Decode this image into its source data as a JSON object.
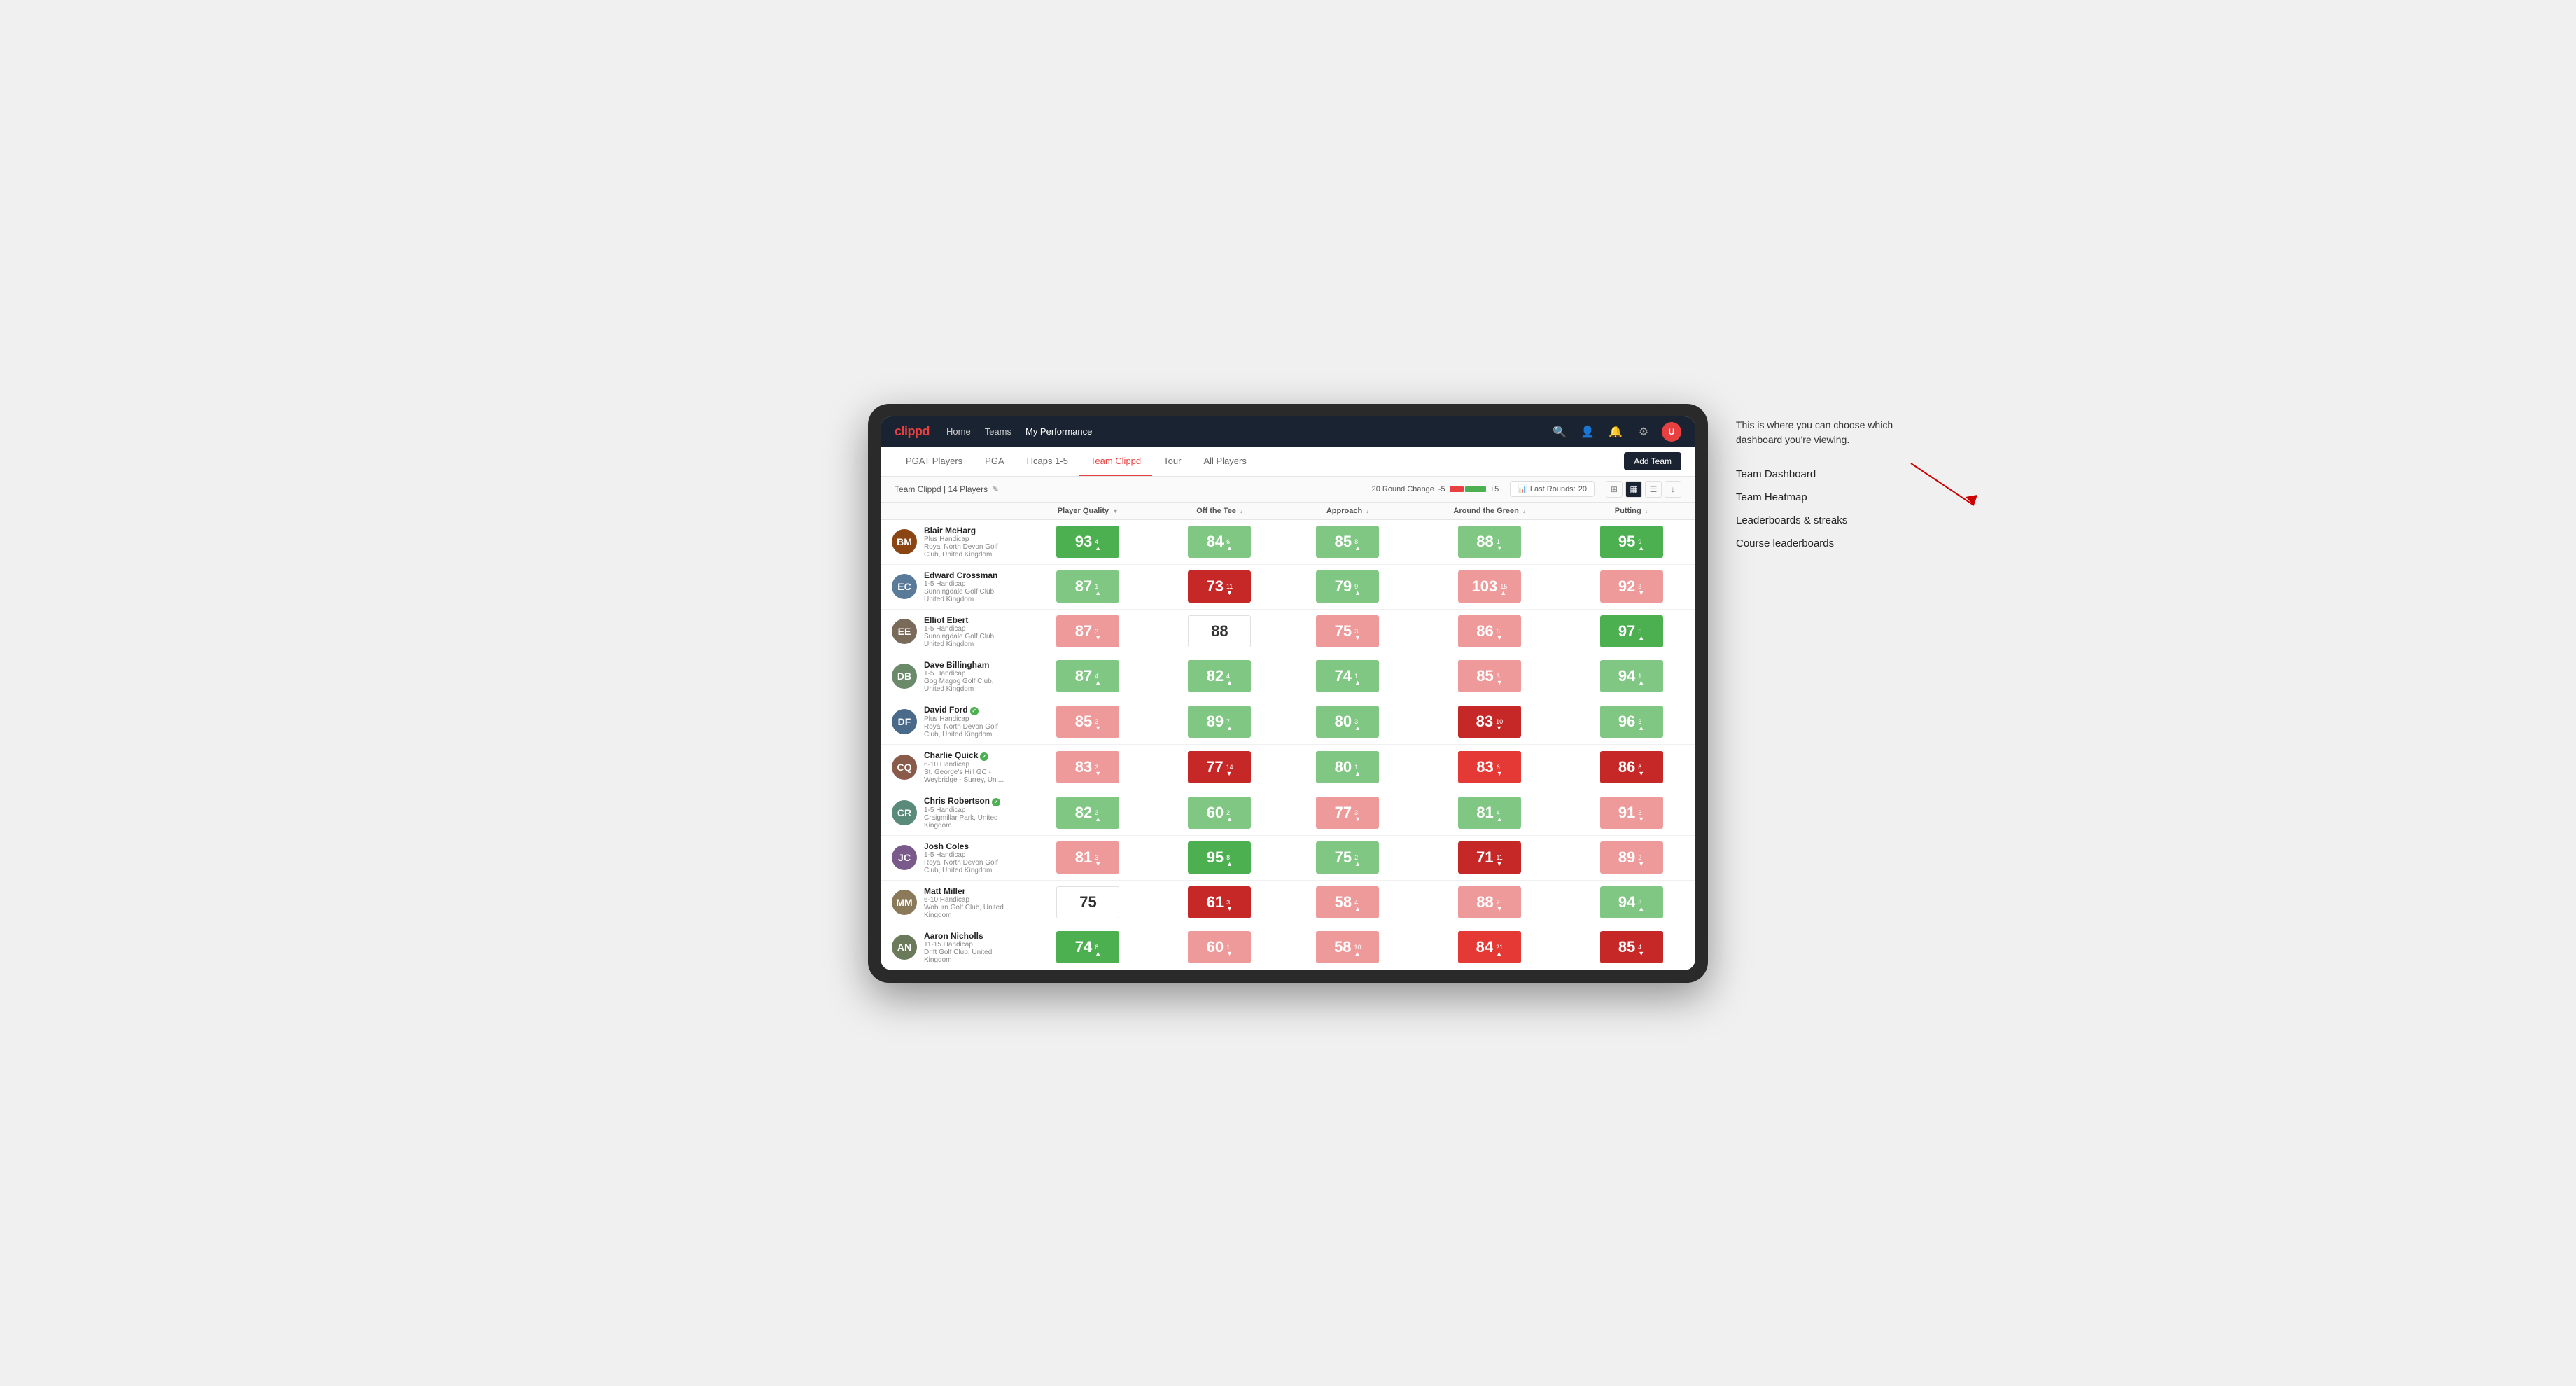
{
  "annotation": {
    "intro": "This is where you can choose which dashboard you're viewing.",
    "items": [
      "Team Dashboard",
      "Team Heatmap",
      "Leaderboards & streaks",
      "Course leaderboards"
    ]
  },
  "navbar": {
    "logo": "clippd",
    "links": [
      "Home",
      "Teams",
      "My Performance"
    ],
    "active_link": "My Performance"
  },
  "subnav": {
    "tabs": [
      "PGAT Players",
      "PGA",
      "Hcaps 1-5",
      "Team Clippd",
      "Tour",
      "All Players"
    ],
    "active_tab": "Team Clippd",
    "add_team_label": "Add Team"
  },
  "toolbar": {
    "team_label": "Team Clippd | 14 Players",
    "round_change_label": "20 Round Change",
    "rc_minus": "-5",
    "rc_plus": "+5",
    "last_rounds_label": "Last Rounds:",
    "last_rounds_value": "20"
  },
  "table": {
    "col_headers": [
      "Player Quality ↓",
      "Off the Tee ↓",
      "Approach ↓",
      "Around the Green ↓",
      "Putting ↓"
    ],
    "players": [
      {
        "name": "Blair McHarg",
        "handicap": "Plus Handicap",
        "club": "Royal North Devon Golf Club, United Kingdom",
        "avatar_color": "#8B4513",
        "initials": "BM",
        "scores": [
          {
            "value": 93,
            "change": "4▲",
            "color": "green-med"
          },
          {
            "value": 84,
            "change": "6▲",
            "color": "green-light"
          },
          {
            "value": 85,
            "change": "8▲",
            "color": "green-light"
          },
          {
            "value": 88,
            "change": "1▼",
            "color": "green-light"
          },
          {
            "value": 95,
            "change": "9▲",
            "color": "green-med"
          }
        ]
      },
      {
        "name": "Edward Crossman",
        "handicap": "1-5 Handicap",
        "club": "Sunningdale Golf Club, United Kingdom",
        "avatar_color": "#5a7a9a",
        "initials": "EC",
        "scores": [
          {
            "value": 87,
            "change": "1▲",
            "color": "green-light"
          },
          {
            "value": 73,
            "change": "11▼",
            "color": "red-dark"
          },
          {
            "value": 79,
            "change": "9▲",
            "color": "green-light"
          },
          {
            "value": 103,
            "change": "15▲",
            "color": "red-light"
          },
          {
            "value": 92,
            "change": "3▼",
            "color": "red-light"
          }
        ]
      },
      {
        "name": "Elliot Ebert",
        "handicap": "1-5 Handicap",
        "club": "Sunningdale Golf Club, United Kingdom",
        "avatar_color": "#7a6a5a",
        "initials": "EE",
        "scores": [
          {
            "value": 87,
            "change": "3▼",
            "color": "red-light"
          },
          {
            "value": 88,
            "change": "",
            "color": "white"
          },
          {
            "value": 75,
            "change": "3▼",
            "color": "red-light"
          },
          {
            "value": 86,
            "change": "6▼",
            "color": "red-light"
          },
          {
            "value": 97,
            "change": "5▲",
            "color": "green-med"
          }
        ]
      },
      {
        "name": "Dave Billingham",
        "handicap": "1-5 Handicap",
        "club": "Gog Magog Golf Club, United Kingdom",
        "avatar_color": "#6a8a6a",
        "initials": "DB",
        "scores": [
          {
            "value": 87,
            "change": "4▲",
            "color": "green-light"
          },
          {
            "value": 82,
            "change": "4▲",
            "color": "green-light"
          },
          {
            "value": 74,
            "change": "1▲",
            "color": "green-light"
          },
          {
            "value": 85,
            "change": "3▼",
            "color": "red-light"
          },
          {
            "value": 94,
            "change": "1▲",
            "color": "green-light"
          }
        ]
      },
      {
        "name": "David Ford",
        "handicap": "Plus Handicap",
        "club": "Royal North Devon Golf Club, United Kingdom",
        "avatar_color": "#4a6a8a",
        "initials": "DF",
        "verified": true,
        "scores": [
          {
            "value": 85,
            "change": "3▼",
            "color": "red-light"
          },
          {
            "value": 89,
            "change": "7▲",
            "color": "green-light"
          },
          {
            "value": 80,
            "change": "3▲",
            "color": "green-light"
          },
          {
            "value": 83,
            "change": "10▼",
            "color": "red-dark"
          },
          {
            "value": 96,
            "change": "3▲",
            "color": "green-light"
          }
        ]
      },
      {
        "name": "Charlie Quick",
        "handicap": "6-10 Handicap",
        "club": "St. George's Hill GC - Weybridge - Surrey, Uni...",
        "avatar_color": "#8a5a4a",
        "initials": "CQ",
        "verified": true,
        "scores": [
          {
            "value": 83,
            "change": "3▼",
            "color": "red-light"
          },
          {
            "value": 77,
            "change": "14▼",
            "color": "red-dark"
          },
          {
            "value": 80,
            "change": "1▲",
            "color": "green-light"
          },
          {
            "value": 83,
            "change": "6▼",
            "color": "red-med"
          },
          {
            "value": 86,
            "change": "8▼",
            "color": "red-dark"
          }
        ]
      },
      {
        "name": "Chris Robertson",
        "handicap": "1-5 Handicap",
        "club": "Craigmillar Park, United Kingdom",
        "avatar_color": "#5a8a7a",
        "initials": "CR",
        "verified": true,
        "scores": [
          {
            "value": 82,
            "change": "3▲",
            "color": "green-light"
          },
          {
            "value": 60,
            "change": "2▲",
            "color": "green-light"
          },
          {
            "value": 77,
            "change": "3▼",
            "color": "red-light"
          },
          {
            "value": 81,
            "change": "4▲",
            "color": "green-light"
          },
          {
            "value": 91,
            "change": "3▼",
            "color": "red-light"
          }
        ]
      },
      {
        "name": "Josh Coles",
        "handicap": "1-5 Handicap",
        "club": "Royal North Devon Golf Club, United Kingdom",
        "avatar_color": "#7a5a8a",
        "initials": "JC",
        "scores": [
          {
            "value": 81,
            "change": "3▼",
            "color": "red-light"
          },
          {
            "value": 95,
            "change": "8▲",
            "color": "green-med"
          },
          {
            "value": 75,
            "change": "2▲",
            "color": "green-light"
          },
          {
            "value": 71,
            "change": "11▼",
            "color": "red-dark"
          },
          {
            "value": 89,
            "change": "2▼",
            "color": "red-light"
          }
        ]
      },
      {
        "name": "Matt Miller",
        "handicap": "6-10 Handicap",
        "club": "Woburn Golf Club, United Kingdom",
        "avatar_color": "#8a7a5a",
        "initials": "MM",
        "scores": [
          {
            "value": 75,
            "change": "",
            "color": "white"
          },
          {
            "value": 61,
            "change": "3▼",
            "color": "red-dark"
          },
          {
            "value": 58,
            "change": "4▲",
            "color": "red-light"
          },
          {
            "value": 88,
            "change": "2▼",
            "color": "red-light"
          },
          {
            "value": 94,
            "change": "3▲",
            "color": "green-light"
          }
        ]
      },
      {
        "name": "Aaron Nicholls",
        "handicap": "11-15 Handicap",
        "club": "Drift Golf Club, United Kingdom",
        "avatar_color": "#6a7a5a",
        "initials": "AN",
        "scores": [
          {
            "value": 74,
            "change": "8▲",
            "color": "green-med"
          },
          {
            "value": 60,
            "change": "1▼",
            "color": "red-light"
          },
          {
            "value": 58,
            "change": "10▲",
            "color": "red-light"
          },
          {
            "value": 84,
            "change": "21▲",
            "color": "red-med"
          },
          {
            "value": 85,
            "change": "4▼",
            "color": "red-dark"
          }
        ]
      }
    ]
  }
}
